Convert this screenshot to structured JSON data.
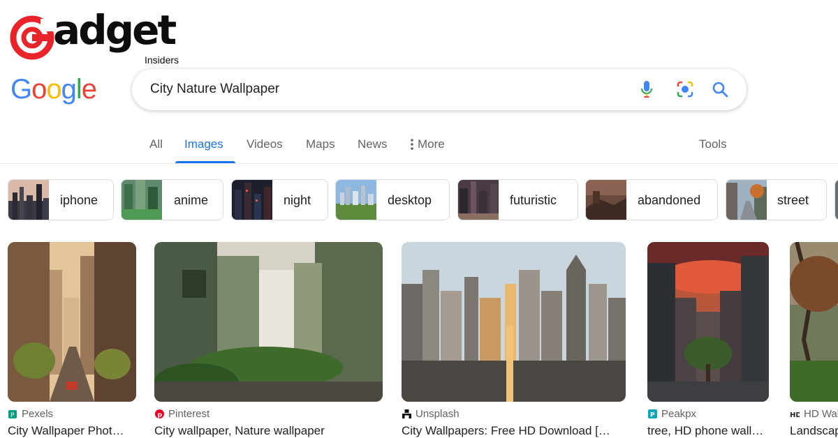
{
  "brand": {
    "watermark_word": "adget",
    "watermark_sub": "Insiders",
    "google_letters": [
      {
        "ch": "G",
        "color": "#4285F4"
      },
      {
        "ch": "o",
        "color": "#EA4335"
      },
      {
        "ch": "o",
        "color": "#FBBC05"
      },
      {
        "ch": "g",
        "color": "#4285F4"
      },
      {
        "ch": "l",
        "color": "#34A853"
      },
      {
        "ch": "e",
        "color": "#EA4335"
      }
    ]
  },
  "search": {
    "query": "City Nature Wallpaper",
    "icons": [
      "microphone-icon",
      "google-lens-icon",
      "magnifier-icon"
    ]
  },
  "tabs": {
    "all": "All",
    "images": "Images",
    "videos": "Videos",
    "maps": "Maps",
    "news": "News",
    "more": "More",
    "tools": "Tools"
  },
  "chips": [
    {
      "label": "iphone"
    },
    {
      "label": "anime"
    },
    {
      "label": "night"
    },
    {
      "label": "desktop"
    },
    {
      "label": "futuristic"
    },
    {
      "label": "abandoned"
    },
    {
      "label": "street"
    }
  ],
  "results": [
    {
      "source": "Pexels",
      "title": "City Wallpaper Phot…"
    },
    {
      "source": "Pinterest",
      "title": "City wallpaper, Nature wallpaper"
    },
    {
      "source": "Unsplash",
      "title": "City Wallpapers: Free HD Download […"
    },
    {
      "source": "Peakpx",
      "title": "tree, HD phone wall…"
    },
    {
      "source": "HD Wallpapers",
      "title": "Landscape"
    }
  ],
  "colors": {
    "accent": "#1a73e8",
    "logo_red": "#e8242a"
  }
}
